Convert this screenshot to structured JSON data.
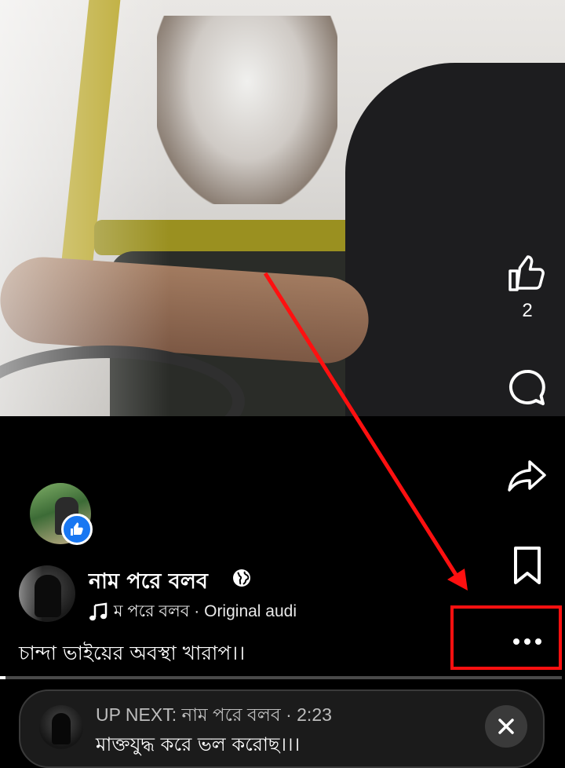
{
  "video": {
    "description_icon": "video-frame"
  },
  "actions": {
    "like_count": "2",
    "like_icon": "thumbs-up-icon",
    "comment_icon": "comment-icon",
    "share_icon": "share-icon",
    "save_icon": "bookmark-icon",
    "more_icon": "more-icon"
  },
  "post": {
    "author_name": "নাম পরে বলব",
    "audio_text": "ম পরে বলব · Original audi",
    "caption": "চান্দা ভাইয়ের অবস্থা খারাপ।।"
  },
  "progress": {
    "fraction": 0.01
  },
  "up_next": {
    "meta": "UP NEXT: নাম পরে বলব · 2:23",
    "title": "মাক্তযুদ্ধ করে ভল করোছ।।।"
  },
  "colors": {
    "annotation": "#ff1010",
    "badge": "#1877f2"
  }
}
